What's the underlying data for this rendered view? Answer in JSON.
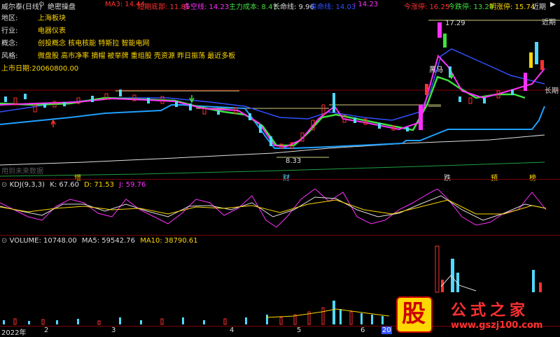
{
  "header": {
    "stock_name": "威尔泰(日线)",
    "formula_label": "绝密操盘",
    "ma3": "MA3: 14.44",
    "short_bottom": "短期底部: 11.81",
    "bull_bear": "多空线: 14.23",
    "main_cost": "主力成本: 8.47",
    "life_line": "长命线: 9.96",
    "hidden_line": "喜命线: 14.03",
    "hidden_val": ": 14.23",
    "today_limit_up": "今涨停: 16.25",
    "today_limit_down": "今跌停: 13.29",
    "tomorrow_limit_up": "明涨停: 15.74",
    "near_label": "近期"
  },
  "info": {
    "region_key": "地区:",
    "region_val": "上海板块",
    "industry_key": "行业:",
    "industry_val": "电器仪表",
    "concept_key": "概念:",
    "concept_val": "创投概念 核电核能 特斯拉 智能电网",
    "style_key": "风格:",
    "style_val": "微盘股 高市净率 摘帽 被举牌 重组股 壳资源 昨日振荡 最近多板",
    "listing_date": "上市日期:20060800.00"
  },
  "price_panel": {
    "high_label": "17.29",
    "low_label": "8.33",
    "heima_label": "黑马",
    "near_label": "近期",
    "long_label": "长期",
    "future_data_note": "用到未来数据",
    "markers": [
      "增",
      "财",
      "跌",
      "预",
      "榜"
    ]
  },
  "kdj": {
    "title": "KDJ(9,3,3)",
    "k": "K: 67.60",
    "d": "D: 71.53",
    "j": "J: 59.76"
  },
  "volume": {
    "title": "VOLUME: 10748.00",
    "ma5": "MA5: 59542.76",
    "ma10": "MA10: 38790.61"
  },
  "time_axis": {
    "labels": [
      "2022年",
      "2",
      "3",
      "4",
      "5",
      "6",
      "20"
    ]
  },
  "watermark": {
    "logo_char": "股",
    "brand": "公式之家",
    "url": "www.gszj100.com"
  },
  "colors": {
    "up": "#ff3030",
    "down": "#50d8ff",
    "ma_green": "#40e040",
    "ma_magenta": "#ff30ff",
    "ma_blue": "#3050ff",
    "cyan_line": "#20a0ff",
    "yellow": "#ffd700"
  }
}
